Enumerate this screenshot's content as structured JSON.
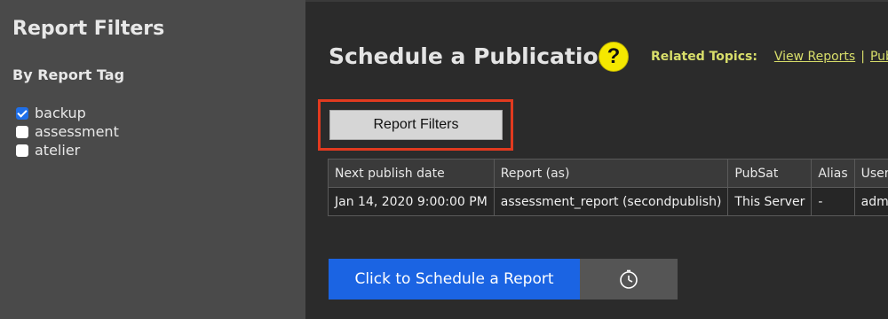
{
  "sidebar": {
    "title": "Report Filters",
    "subtitle": "By Report Tag",
    "tags": [
      {
        "label": "backup",
        "checked": true
      },
      {
        "label": "assessment",
        "checked": false
      },
      {
        "label": "atelier",
        "checked": false
      }
    ]
  },
  "main": {
    "title": "Schedule a Publication",
    "help_icon": "question-mark-icon",
    "related_label": "Related Topics:",
    "related_links": [
      "View Reports",
      "Pub"
    ],
    "filter_button_label": "Report Filters",
    "table": {
      "headers": [
        "Next publish date",
        "Report (as)",
        "PubSat",
        "Alias",
        "User"
      ],
      "rows": [
        [
          "Jan 14, 2020 9:00:00 PM",
          "assessment_report (secondpublish)",
          "This Server",
          "-",
          "admin"
        ]
      ]
    },
    "schedule_button_label": "Click to Schedule a Report",
    "clock_icon": "clock-icon"
  },
  "colors": {
    "sidebar_bg": "#4a4a4a",
    "main_bg": "#2b2b2b",
    "accent_blue": "#1b64e3",
    "help_yellow": "#f5e800",
    "link_yellow": "#d8de6a",
    "highlight_red": "#e23a1f"
  }
}
